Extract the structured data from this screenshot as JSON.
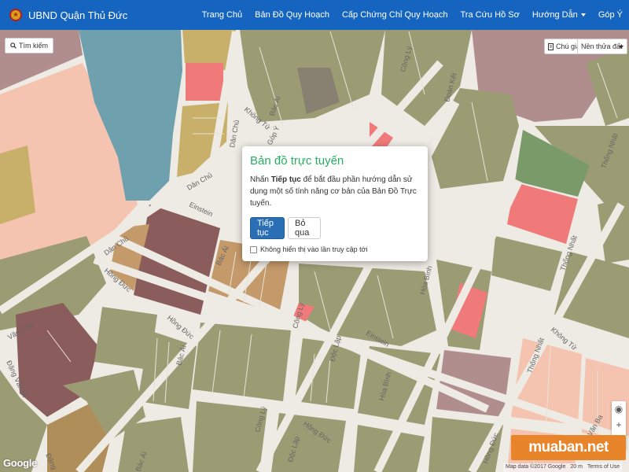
{
  "app": {
    "title": "UBND Quận Thủ Đức",
    "nav": [
      {
        "label": "Trang Chủ"
      },
      {
        "label": "Bản Đồ Quy Hoạch"
      },
      {
        "label": "Cấp Chứng Chỉ Quy Hoạch"
      },
      {
        "label": "Tra Cứu Hồ Sơ"
      },
      {
        "label": "Hướng Dẫn"
      },
      {
        "label": "Góp Ý"
      }
    ]
  },
  "map": {
    "search_label": "Tìm kiếm",
    "legend_label": "Chú giải",
    "basemap_selected": "Nền thửa đất",
    "streets": {
      "cong_ly": "Công Lý",
      "doan_ket": "Đoàn Kết",
      "khong_tu": "Không Tử",
      "bac_ai": "Bác Ái",
      "dan_chu": "Dân Chủ",
      "einstein": "Einstein",
      "hong_duc": "Hồng Đức",
      "thong_nhat": "Thống Nhất",
      "hoa_binh": "Hòa Bình",
      "doc_lap": "Độc Lập",
      "van_chu": "Văn Chu",
      "dang_van_bi": "Đặng Văn Bi",
      "dang": "Đặng",
      "van_ba": "Văn Ba",
      "gop_y": "Góp Ý"
    },
    "zoom_in": "+",
    "zoom_out": "−",
    "locate": "◉",
    "attribution": {
      "data": "Map data ©2017 Google",
      "scale": "20 m",
      "terms": "Terms of Use"
    },
    "google_logo": "Google",
    "watermark": "muaban.net",
    "colors": {
      "residential": "#9c9c74",
      "commercial": "#b08e8e",
      "water": "#6ea0ad",
      "park": "#7a9a6a",
      "red_zone": "#f07a7a",
      "pink_zone": "#f5c4b0",
      "tan": "#c8b06a",
      "road": "#eeeae4",
      "dark": "#8a5c5c"
    }
  },
  "modal": {
    "title": "Bản đồ trực tuyến",
    "body_pre": "Nhấn ",
    "body_bold": "Tiếp tục",
    "body_post": " để bắt đầu phần hướng dẫn sử dụng một số tính năng cơ bản của Bản Đồ Trực tuyến.",
    "continue_label": "Tiếp tục",
    "skip_label": "Bỏ qua",
    "checkbox_label": "Không hiển thị vào lần truy cập tới"
  }
}
